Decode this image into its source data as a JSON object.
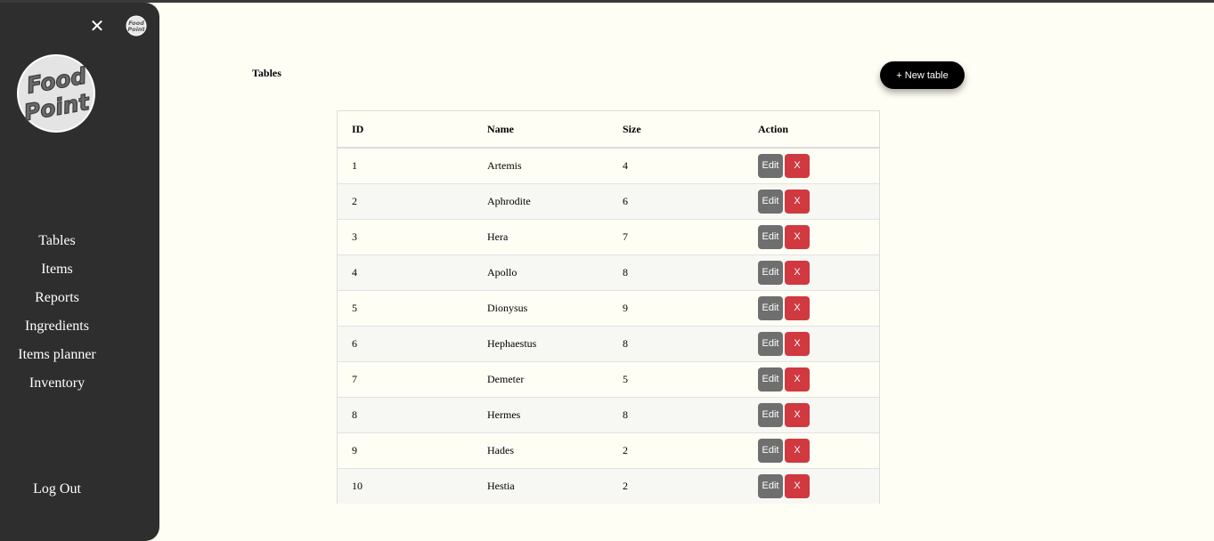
{
  "sidebar": {
    "logo_text": [
      "Food",
      "Point"
    ],
    "nav": [
      "Tables",
      "Items",
      "Reports",
      "Ingredients",
      "Items planner",
      "Inventory"
    ],
    "logout_label": "Log Out"
  },
  "main": {
    "title": "Tables",
    "new_button_label": "+ New table",
    "columns": [
      "ID",
      "Name",
      "Size",
      "Action"
    ],
    "edit_label": "Edit",
    "delete_label": "X",
    "rows": [
      {
        "id": "1",
        "name": "Artemis",
        "size": "4"
      },
      {
        "id": "2",
        "name": "Aphrodite",
        "size": "6"
      },
      {
        "id": "3",
        "name": "Hera",
        "size": "7"
      },
      {
        "id": "4",
        "name": "Apollo",
        "size": "8"
      },
      {
        "id": "5",
        "name": "Dionysus",
        "size": "9"
      },
      {
        "id": "6",
        "name": "Hephaestus",
        "size": "8"
      },
      {
        "id": "7",
        "name": "Demeter",
        "size": "5"
      },
      {
        "id": "8",
        "name": "Hermes",
        "size": "8"
      },
      {
        "id": "9",
        "name": "Hades",
        "size": "2"
      },
      {
        "id": "10",
        "name": "Hestia",
        "size": "2"
      }
    ]
  },
  "colors": {
    "sidebar_bg": "#2e2e2e",
    "page_bg": "#fffef5",
    "edit_button": "#6f6f6f",
    "delete_button": "#d0393f"
  }
}
